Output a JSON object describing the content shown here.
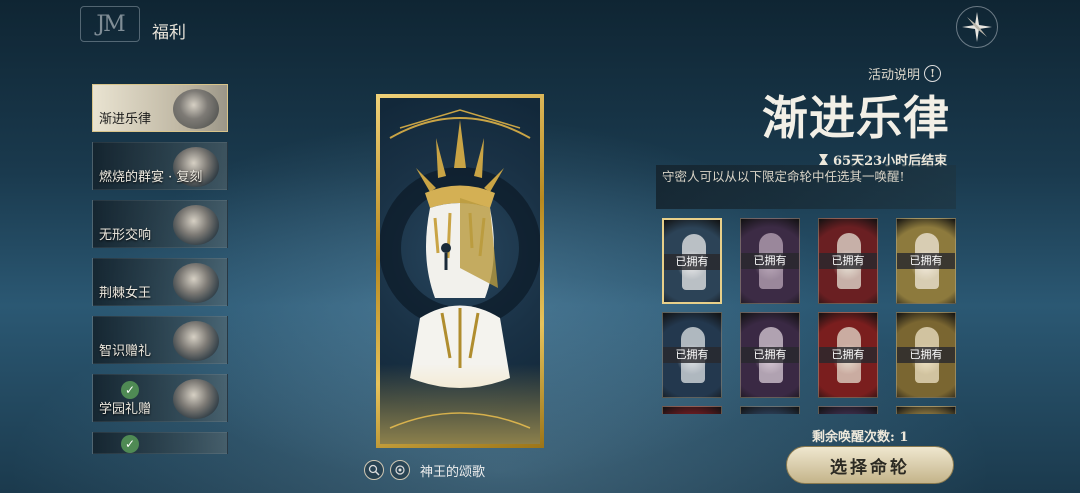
{
  "header": {
    "logo_text": "JM",
    "title": "福利"
  },
  "sidebar": {
    "items": [
      {
        "label": "渐进乐律",
        "active": true,
        "checked": false
      },
      {
        "label": "燃烧的群宴 · 复刻",
        "active": false,
        "checked": false
      },
      {
        "label": "无形交响",
        "active": false,
        "checked": false
      },
      {
        "label": "荆棘女王",
        "active": false,
        "checked": false
      },
      {
        "label": "智识赠礼",
        "active": false,
        "checked": false
      },
      {
        "label": "学园礼赠",
        "active": false,
        "checked": true
      },
      {
        "label": "",
        "active": false,
        "checked": true
      }
    ]
  },
  "card": {
    "name": "神王的颂歌"
  },
  "event": {
    "rules_label": "活动说明",
    "title": "渐进乐律",
    "timer": "65天23小时后结束",
    "description": "守密人可以从以下限定命轮中任选其一唤醒!",
    "owned_label": "已拥有",
    "remaining": "剩余唤醒次数: 1",
    "select_button": "选择命轮"
  },
  "tiles": [
    {
      "id": "t1",
      "color": "#2c4357",
      "accent": "#e9e9ea",
      "owned": true,
      "selected": true
    },
    {
      "id": "t2",
      "color": "#3c2b45",
      "accent": "#b9a7b8",
      "owned": true,
      "selected": false
    },
    {
      "id": "t3",
      "color": "#6a1f22",
      "accent": "#e7e1d6",
      "owned": true,
      "selected": false
    },
    {
      "id": "t4",
      "color": "#8d7a3d",
      "accent": "#f1eadb",
      "owned": true,
      "selected": false
    },
    {
      "id": "t5",
      "color": "#23384e",
      "accent": "#dfe3e6",
      "owned": true,
      "selected": false
    },
    {
      "id": "t6",
      "color": "#3a2944",
      "accent": "#d8cbd6",
      "owned": true,
      "selected": false
    },
    {
      "id": "t7",
      "color": "#7a1e1e",
      "accent": "#e6dccd",
      "owned": true,
      "selected": false
    },
    {
      "id": "t8",
      "color": "#7a6631",
      "accent": "#efe3c5",
      "owned": true,
      "selected": false
    },
    {
      "id": "t9",
      "color": "#6b1c22",
      "accent": "#c7b69c",
      "owned": false,
      "selected": false
    },
    {
      "id": "t10",
      "color": "#2b3e56",
      "accent": "#d7dde3",
      "owned": false,
      "selected": false
    },
    {
      "id": "t11",
      "color": "#3c2d4a",
      "accent": "#a89ab5",
      "owned": false,
      "selected": false
    },
    {
      "id": "t12",
      "color": "#8a7640",
      "accent": "#e8dcc0",
      "owned": false,
      "selected": false
    }
  ],
  "colors": {
    "accent_gold": "#d8c48a",
    "panel_dark": "#14232d",
    "checked_green": "#4f8a54"
  }
}
